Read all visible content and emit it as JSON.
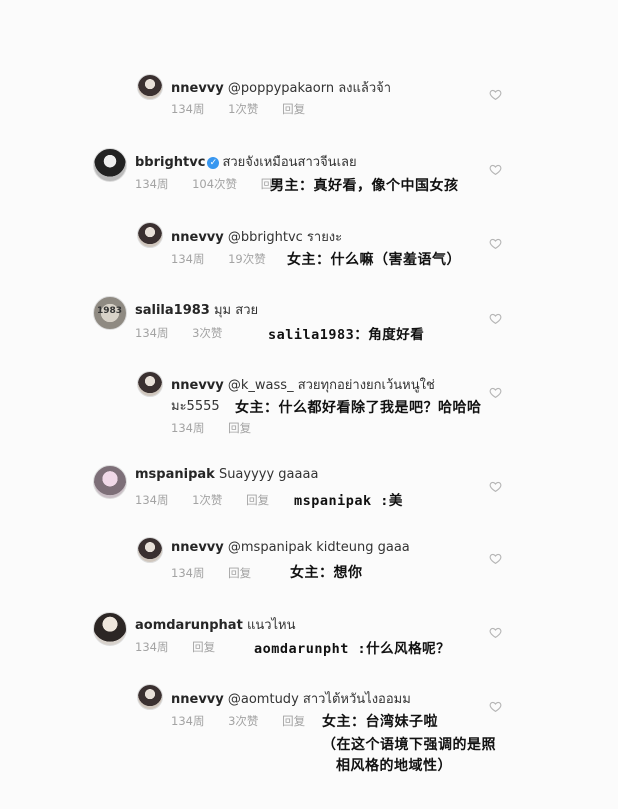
{
  "comments": [
    {
      "user": "nnevvy",
      "text": "@poppypakaorn ลงแล้วจ้า",
      "time": "134周",
      "likes": "1次赞",
      "reply": "回复"
    },
    {
      "user": "bbrightvc",
      "text": "สวยจังเหมือนสาวจีนเลย",
      "time": "134周",
      "likes": "104次赞",
      "reply": "回复",
      "caption": "男主：真好看，像个中国女孩"
    },
    {
      "user": "nnevvy",
      "text": "@bbrightvc รายงะ",
      "time": "134周",
      "likes": "19次赞",
      "reply": "回复",
      "caption": "女主：什么嘛（害羞语气）"
    },
    {
      "user": "salila1983",
      "text": "มุม สวย",
      "time": "134周",
      "likes": "3次赞",
      "reply": "回复",
      "caption": "salila1983：角度好看",
      "avatar_text": "1983"
    },
    {
      "user": "nnevvy",
      "text": "@k_wass_ สวยทุกอย่างยกเว้นหนูใช่",
      "text2": "มะ5555",
      "time": "134周",
      "reply": "回复",
      "caption": "女主：什么都好看除了我是吧？哈哈哈"
    },
    {
      "user": "mspanipak",
      "text": "Suayyyy gaaaa",
      "time": "134周",
      "likes": "1次赞",
      "reply": "回复",
      "caption": "mspanipak :美"
    },
    {
      "user": "nnevvy",
      "text": "@mspanipak kidteung gaaa",
      "time": "134周",
      "reply": "回复",
      "caption": "女主：想你"
    },
    {
      "user": "aomdarunphat",
      "text": "แนวไหน",
      "time": "134周",
      "reply": "回复",
      "caption": "aomdarunpht :什么风格呢？"
    },
    {
      "user": "nnevvy",
      "text": "@aomtudy สาวไต้หวันไงออมม",
      "time": "134周",
      "likes": "3次赞",
      "reply": "回复",
      "caption": "女主：台湾妹子啦",
      "caption2": "（在这个语境下强调的是照",
      "caption3": "相风格的地域性）"
    }
  ]
}
